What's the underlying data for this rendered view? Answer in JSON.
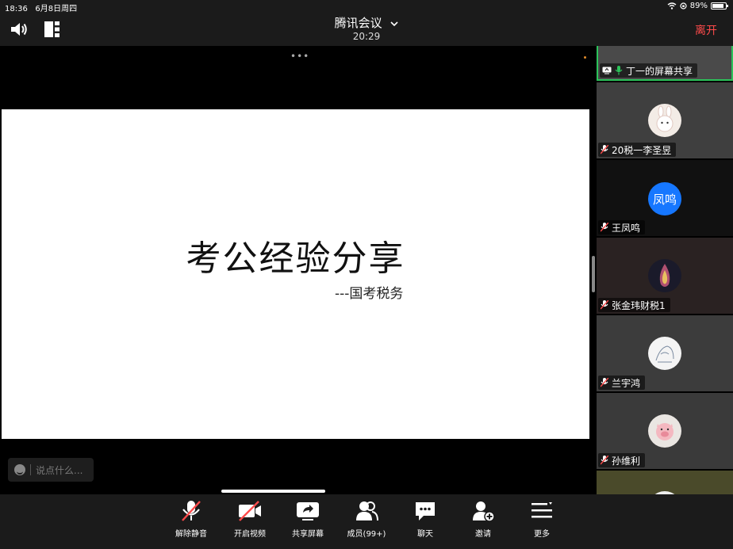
{
  "statusbar": {
    "time": "18:36",
    "date": "6月8日周四",
    "battery": "89%"
  },
  "header": {
    "title": "腾讯会议",
    "duration": "20:29",
    "leave_label": "离开"
  },
  "slide": {
    "title": "考公经验分享",
    "subtitle": "---国考税务"
  },
  "chat": {
    "placeholder": "说点什么..."
  },
  "participants": [
    {
      "name": "丁一的屏幕共享",
      "muted": false,
      "active": true
    },
    {
      "name": "20税一李圣昱",
      "muted": true
    },
    {
      "name": "王凤鸣",
      "muted": true,
      "avatar_text": "凤鸣",
      "avatar_color": "#1677ff"
    },
    {
      "name": "张金玮财税1",
      "muted": true
    },
    {
      "name": "兰宇鸿",
      "muted": true
    },
    {
      "name": "孙维利",
      "muted": true
    }
  ],
  "toolbar": {
    "unmute": "解除静音",
    "video": "开启视频",
    "share": "共享屏幕",
    "members": "成员(99+)",
    "chat": "聊天",
    "invite": "邀请",
    "more": "更多"
  },
  "colors": {
    "leave": "#ff4b4b",
    "active_border": "#2cc35a",
    "muted_icon": "#ff4b4b"
  }
}
